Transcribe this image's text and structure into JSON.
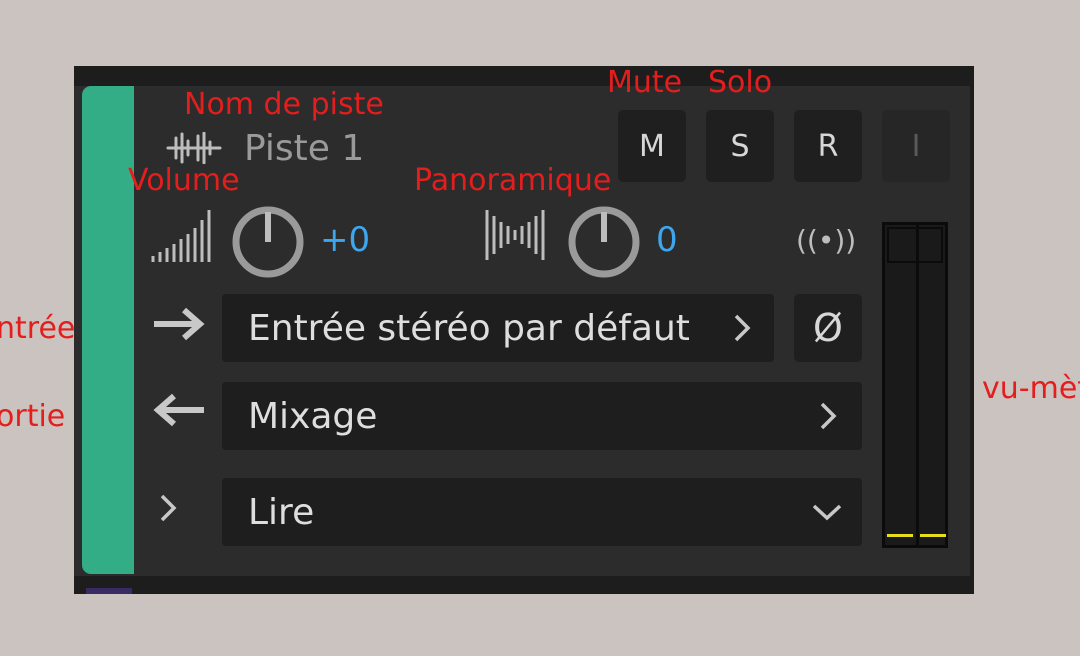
{
  "annotations": {
    "track_name": "Nom de piste",
    "mute": "Mute",
    "solo": "Solo",
    "volume": "Volume",
    "pan": "Panoramique",
    "input": "ntrée",
    "output": "ortie",
    "meter": "vu-mèt"
  },
  "track": {
    "name": "Piste 1",
    "color": "#33ad86",
    "icon": "waveform-icon"
  },
  "buttons": {
    "mute": "M",
    "solo": "S",
    "record": "R",
    "input_monitor": "I"
  },
  "volume": {
    "value": "+0",
    "icon": "volume-bars-icon"
  },
  "pan": {
    "value": "0",
    "icon": "pan-bars-icon"
  },
  "broadcast_icon": "((•))",
  "input": {
    "label": "Entrée stéréo par défaut",
    "icon": "arrow-right-icon"
  },
  "polarity": {
    "symbol": "Ø"
  },
  "output": {
    "label": "Mixage",
    "icon": "arrow-left-icon"
  },
  "automation": {
    "label": "Lire",
    "expand_icon": "chevron-right-icon"
  },
  "colors": {
    "accent_value": "#3ea6ee",
    "meter_level": "#e6dd1e",
    "annotation": "#e41d1d"
  }
}
